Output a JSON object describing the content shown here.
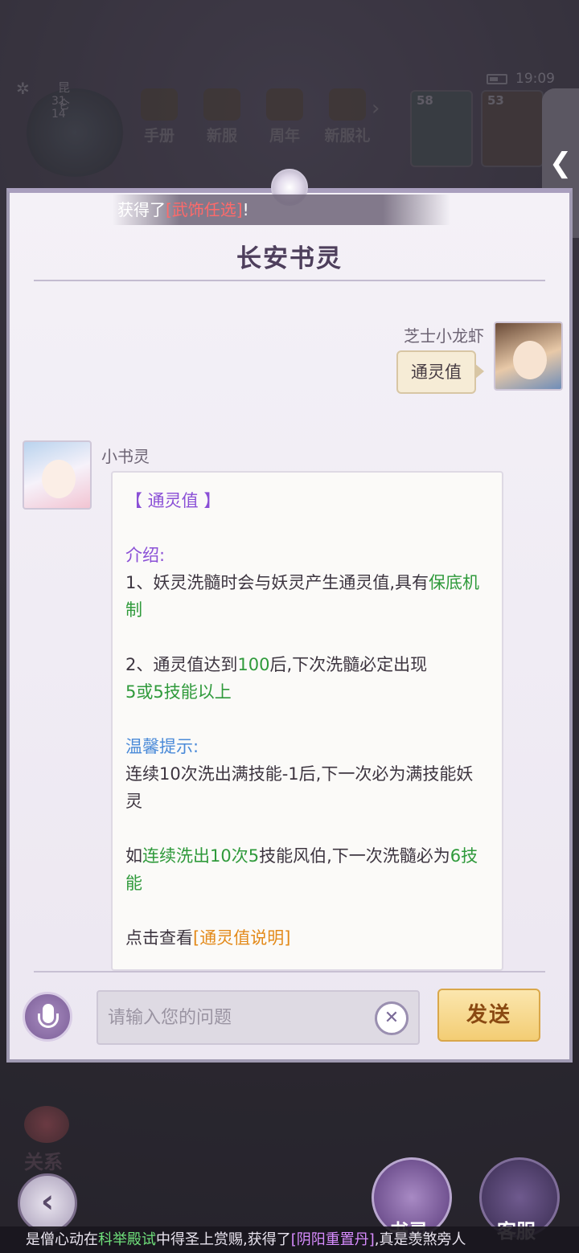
{
  "status_bar": {
    "time": "19:09"
  },
  "location": {
    "name": "昆仑",
    "coords": "31 14",
    "gear_icon": "gear-icon"
  },
  "top_nav": {
    "items": [
      {
        "label": "手册",
        "icon": "handbook-icon"
      },
      {
        "label": "新服",
        "icon": "new-server-icon"
      },
      {
        "label": "周年",
        "icon": "anniversary-icon"
      },
      {
        "label": "新服礼",
        "icon": "new-server-gift-icon"
      }
    ],
    "more_icon": "chevron-right-icon"
  },
  "hero_cards": [
    {
      "level": "58"
    },
    {
      "level": "53"
    }
  ],
  "side_toggle": {
    "icon": "chevron-left-icon",
    "glyph": "❮"
  },
  "toast": {
    "prefix": "获得了",
    "item": "[武饰任选]",
    "suffix": "!"
  },
  "dialog": {
    "title": "长安书灵",
    "user": {
      "name": "芝士小龙虾",
      "message": "通灵值"
    },
    "bot": {
      "name": "小书灵",
      "heading": "【 通灵值 】",
      "intro_label": "介绍:",
      "line1_a": "1、妖灵洗髓时会与妖灵产生通灵值,具有",
      "line1_b": "保底机制",
      "line2_a": "2、通灵值达到",
      "line2_b": "100",
      "line2_c": "后,下次洗髓必定出现",
      "line2_d": "5或5技能以上",
      "tip_label": "温馨提示:",
      "tip1": "连续10次洗出满技能-1后,下一次必为满技能妖灵",
      "tip2_a": "如",
      "tip2_b": "连续洗出10次5",
      "tip2_c": "技能风伯,下一次洗髓必为",
      "tip2_d": "6技能",
      "link_prefix": "点击查看",
      "link_text": "[通灵值说明]"
    }
  },
  "input_bar": {
    "mic_icon": "microphone-icon",
    "placeholder": "请输入您的问题",
    "clear_glyph": "✕",
    "send_label": "发送"
  },
  "hud": {
    "relation_label": "关系",
    "back_glyph": "‹",
    "shuling_label": "书灵",
    "kefu_label": "客服"
  },
  "marquee": {
    "part1": "是僧心动在",
    "part2": "科举殿试",
    "part3": "中得圣上赏赐,获得了",
    "part4": "[阴阳重置丹]",
    "part5": ",真是羡煞旁人"
  }
}
